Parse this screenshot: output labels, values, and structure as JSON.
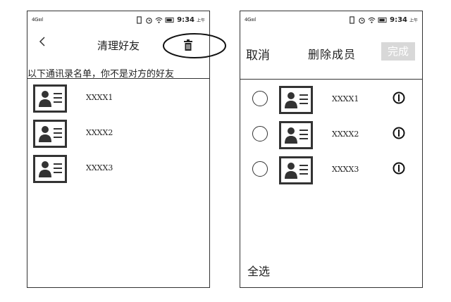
{
  "status_bar": {
    "network": "4G",
    "time": "9:34",
    "ampm": "上午",
    "icons": [
      "signal-icon",
      "vibrate-icon",
      "alarm-icon",
      "wifi-icon",
      "battery-icon"
    ]
  },
  "left_screen": {
    "title": "清理好友",
    "notice": "以下通讯录名单，你不是对方的好友",
    "contacts": [
      {
        "name": "XXXX1"
      },
      {
        "name": "XXXX2"
      },
      {
        "name": "XXXX3"
      }
    ]
  },
  "right_screen": {
    "cancel_label": "取消",
    "title": "删除成员",
    "done_label": "完成",
    "select_all_label": "全选",
    "members": [
      {
        "name": "XXXX1"
      },
      {
        "name": "XXXX2"
      },
      {
        "name": "XXXX3"
      }
    ]
  },
  "colors": {
    "outline": "#333333",
    "done_disabled_bg": "#d8d8d8"
  }
}
